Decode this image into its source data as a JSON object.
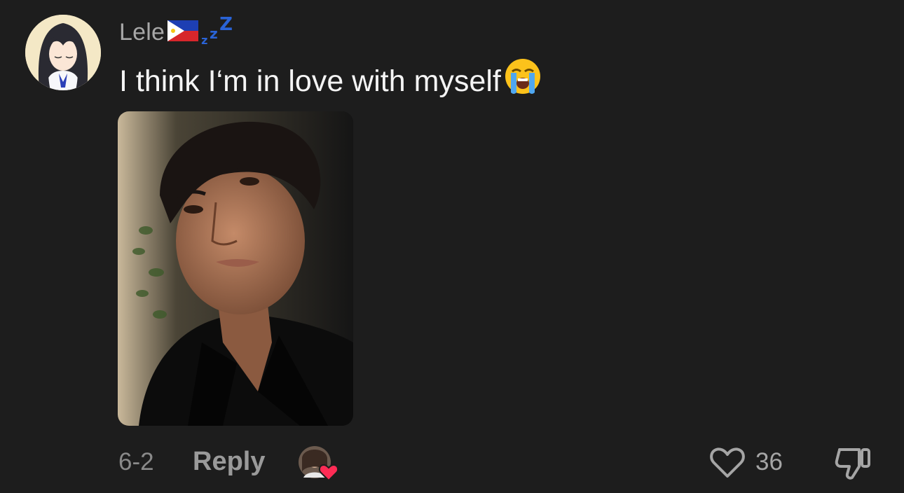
{
  "comment": {
    "username": "Lele",
    "username_flag": "philippines-flag",
    "username_status_emoji": "zzz-sleeping",
    "text": "I think I‘m in love with myself",
    "text_emoji": "loudly-crying-face",
    "attached_image": "selfie-photo",
    "date": "6-2",
    "reply_label": "Reply",
    "likes": "36",
    "liked_by_creator": true
  },
  "icons": {
    "like": "heart-outline-icon",
    "dislike": "thumbs-down-icon",
    "creator_like": "creator-avatar-heart-icon"
  },
  "colors": {
    "background": "#1d1d1d",
    "username": "#a7a7a7",
    "text": "#f4f4f4",
    "meta": "#8a8a8a",
    "creator_heart": "#fe2c55"
  }
}
